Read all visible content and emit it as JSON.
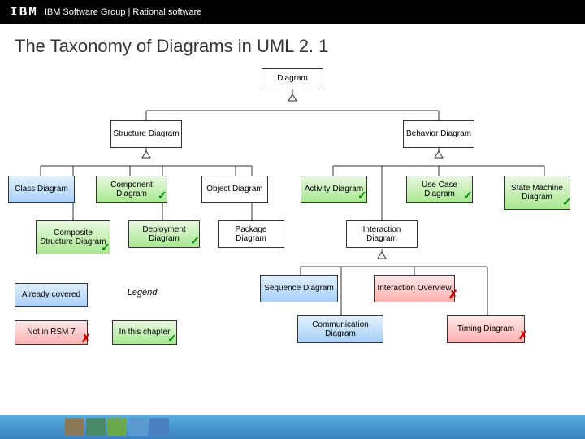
{
  "header": {
    "logo": "IBM",
    "text": "IBM Software Group | Rational software"
  },
  "title": "The Taxonomy of Diagrams in UML 2. 1",
  "nodes": {
    "root": "Diagram",
    "structure": "Structure Diagram",
    "behavior": "Behavior Diagram",
    "class": "Class Diagram",
    "component": "Component Diagram",
    "object": "Object Diagram",
    "activity": "Activity Diagram",
    "usecase": "Use Case Diagram",
    "statemachine": "State Machine Diagram",
    "composite": "Composite Structure Diagram",
    "deployment": "Deployment Diagram",
    "package": "Package Diagram",
    "interaction": "Interaction Diagram",
    "sequence": "Sequence Diagram",
    "interactionoverview": "Interaction Overview",
    "communication": "Communication Diagram",
    "timing": "Timing Diagram"
  },
  "legend": {
    "title": "Legend",
    "covered": "Already covered",
    "notin": "Not in RSM 7",
    "inchapter": "In this chapter"
  },
  "marks": {
    "ok": "✓",
    "no": "✗"
  }
}
